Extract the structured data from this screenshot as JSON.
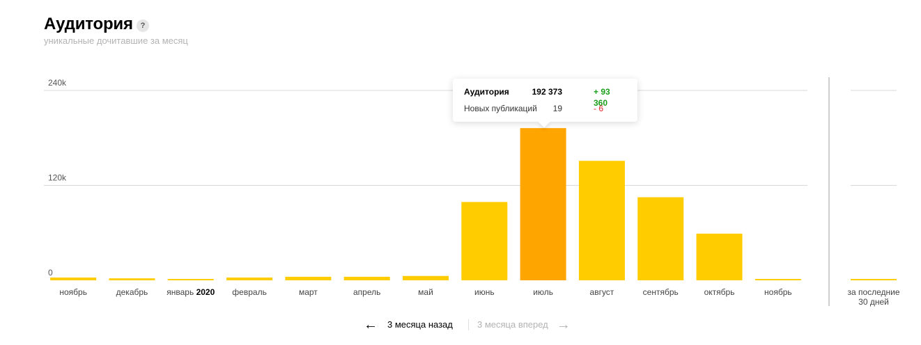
{
  "header": {
    "title": "Аудитория",
    "help_label": "?",
    "subtitle": "уникальные дочитавшие за месяц"
  },
  "colors": {
    "bar": "#ffcc00",
    "bar_active": "#ffa500",
    "grid": "#d9d9d9",
    "delta_positive": "#1a9e1a",
    "delta_negative": "#e8202a"
  },
  "chart_data": {
    "type": "bar",
    "title": "Аудитория",
    "subtitle": "уникальные дочитавшие за месяц",
    "ylim": [
      0,
      240000
    ],
    "yticks": [
      {
        "value": 240000,
        "label": "240k"
      },
      {
        "value": 120000,
        "label": "120k"
      },
      {
        "value": 0,
        "label": "0"
      }
    ],
    "categories": [
      "ноябрь",
      "декабрь",
      "январь 2020",
      "февраль",
      "март",
      "апрель",
      "май",
      "июнь",
      "июль",
      "август",
      "сентябрь",
      "октябрь",
      "ноябрь"
    ],
    "category_parts": [
      {
        "text": "ноябрь",
        "bold": ""
      },
      {
        "text": "декабрь",
        "bold": ""
      },
      {
        "text": "январь ",
        "bold": "2020"
      },
      {
        "text": "февраль",
        "bold": ""
      },
      {
        "text": "март",
        "bold": ""
      },
      {
        "text": "апрель",
        "bold": ""
      },
      {
        "text": "май",
        "bold": ""
      },
      {
        "text": "июнь",
        "bold": ""
      },
      {
        "text": "июль",
        "bold": ""
      },
      {
        "text": "август",
        "bold": ""
      },
      {
        "text": "сентябрь",
        "bold": ""
      },
      {
        "text": "октябрь",
        "bold": ""
      },
      {
        "text": "ноябрь",
        "bold": ""
      }
    ],
    "values": [
      3500,
      2500,
      1500,
      3500,
      4500,
      4500,
      5500,
      99000,
      192373,
      151000,
      105000,
      59000,
      1500
    ],
    "highlighted_index": 8,
    "last_30_days": {
      "label": "за последние 30 дней",
      "label_lines": [
        "за последние",
        "30 дней"
      ],
      "value": 1500
    },
    "grid": true,
    "legend": "none"
  },
  "tooltip": {
    "row1": {
      "label": "Аудитория",
      "value": "192 373",
      "delta": "+ 93 360"
    },
    "row2": {
      "label": "Новых публикаций",
      "value": "19",
      "delta": "- 6"
    }
  },
  "nav": {
    "back_label": "3 месяца назад",
    "back_icon": "arrow-left-icon",
    "forward_label": "3 месяца вперед",
    "forward_icon": "arrow-right-icon"
  }
}
